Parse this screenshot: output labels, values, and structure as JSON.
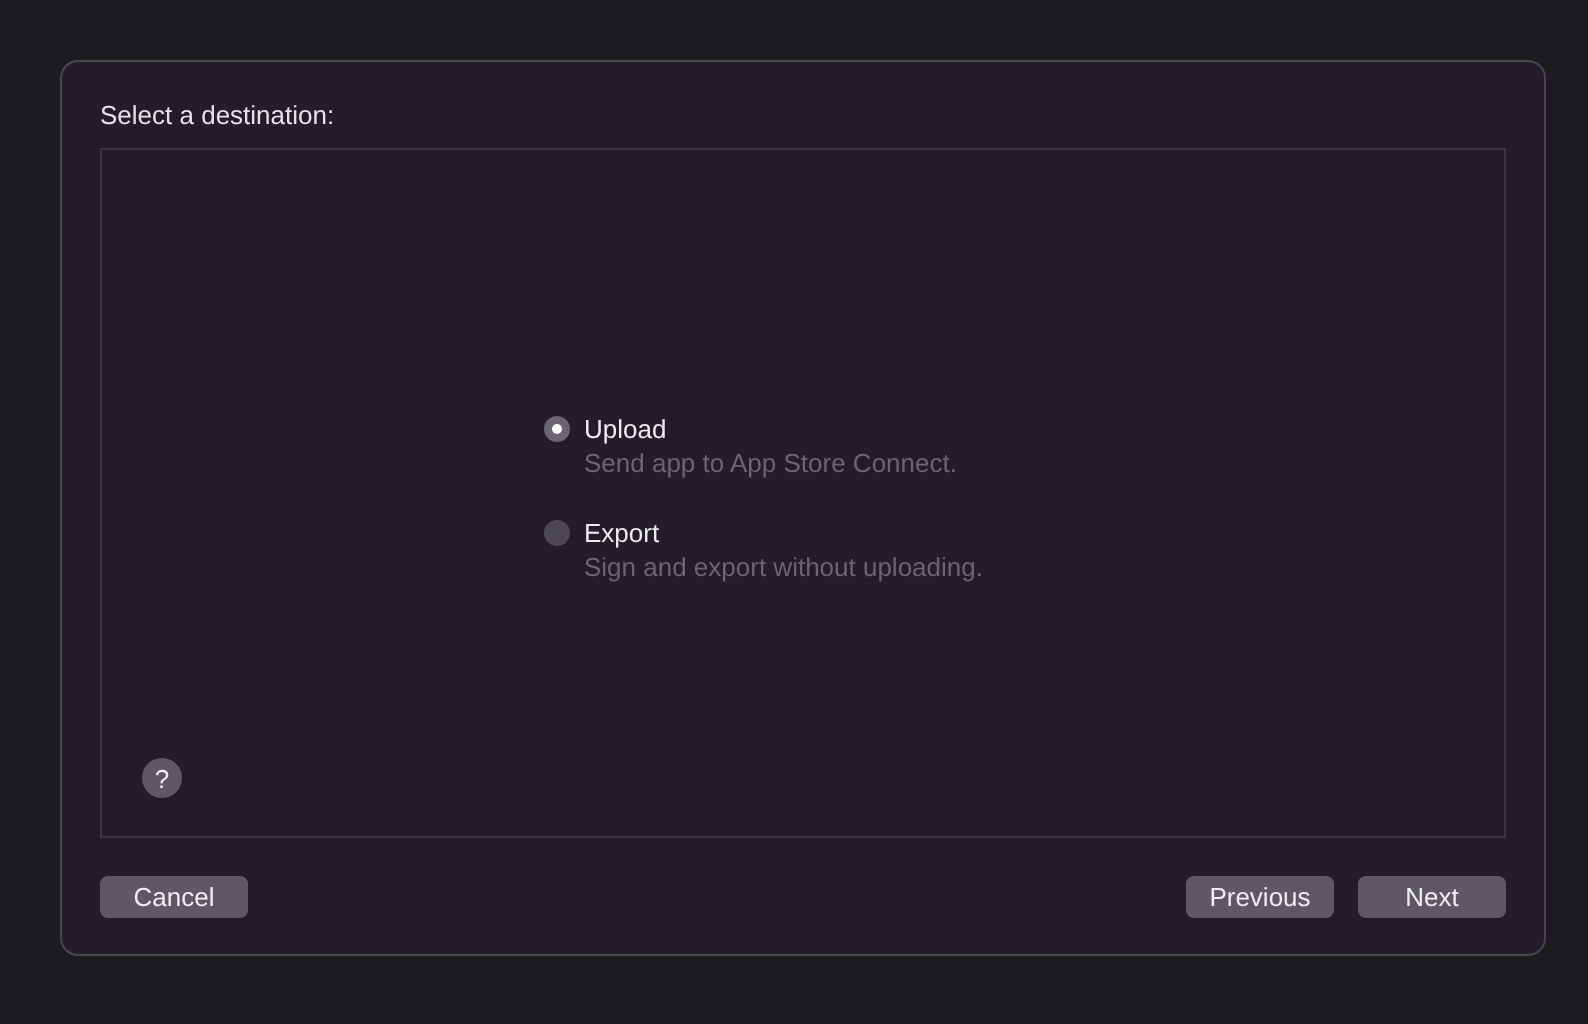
{
  "dialog": {
    "title": "Select a destination:"
  },
  "options": [
    {
      "label": "Upload",
      "description": "Send app to App Store Connect.",
      "selected": true
    },
    {
      "label": "Export",
      "description": "Sign and export without uploading.",
      "selected": false
    }
  ],
  "help_button": "?",
  "buttons": [
    {
      "label": "Cancel",
      "kind": "left"
    },
    {
      "label": "Previous",
      "kind": "right"
    },
    {
      "label": "Next",
      "kind": "right"
    }
  ]
}
